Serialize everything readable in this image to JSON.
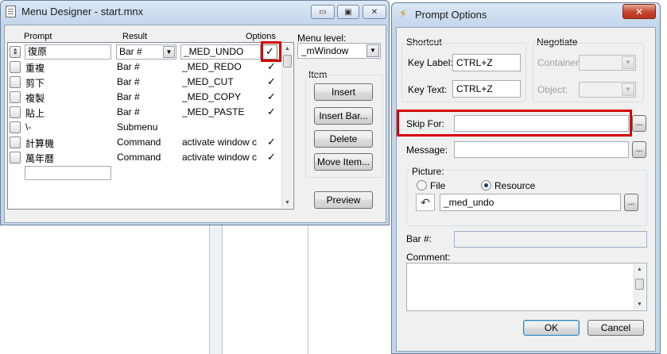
{
  "menu_designer": {
    "title": "Menu Designer - start.mnx",
    "minimize_glyph": "▭",
    "maximize_glyph": "▣",
    "close_glyph": "✕",
    "columns": {
      "prompt": "Prompt",
      "result": "Result",
      "options": "Options"
    },
    "rows": [
      {
        "prompt": "復原",
        "result": "Bar #",
        "target": "_MED_UNDO",
        "check": "✓"
      },
      {
        "prompt": "重複",
        "result": "Bar #",
        "target": "_MED_REDO",
        "check": "✓"
      },
      {
        "prompt": "剪下",
        "result": "Bar #",
        "target": "_MED_CUT",
        "check": "✓"
      },
      {
        "prompt": "複製",
        "result": "Bar #",
        "target": "_MED_COPY",
        "check": "✓"
      },
      {
        "prompt": "貼上",
        "result": "Bar #",
        "target": "_MED_PASTE",
        "check": "✓"
      },
      {
        "prompt": "\\-",
        "result": "Submenu",
        "target": "",
        "check": ""
      },
      {
        "prompt": "計算機",
        "result": "Command",
        "target": "activate window c",
        "check": "✓"
      },
      {
        "prompt": "萬年曆",
        "result": "Command",
        "target": "activate window c",
        "check": "✓"
      }
    ],
    "menu_level_label": "Menu level:",
    "menu_level_value": "_mWindow",
    "item_group_label": "Item",
    "buttons": {
      "insert": "Insert",
      "insert_bar": "Insert Bar...",
      "delete": "Delete",
      "move_item": "Move Item...",
      "preview": "Preview"
    }
  },
  "prompt_options": {
    "title": "Prompt Options",
    "close_glyph": "✕",
    "shortcut_group": "Shortcut",
    "key_label_label": "Key Label:",
    "key_label_value": "CTRL+Z",
    "key_text_label": "Key Text:",
    "key_text_value": "CTRL+Z",
    "negotiate_group": "Negotiate",
    "container_label": "Container:",
    "object_label": "Object:",
    "skip_for_label": "Skip For:",
    "skip_for_value": "",
    "message_label": "Message:",
    "message_value": "",
    "ellipsis": "...",
    "picture_group": "Picture:",
    "file_label": "File",
    "resource_label": "Resource",
    "picture_value": "_med_undo",
    "bar_no_label": "Bar #:",
    "comment_label": "Comment:",
    "ok_label": "OK",
    "cancel_label": "Cancel"
  },
  "colors": {
    "highlight": "#d40000",
    "title_bar": "#c4d6ec"
  }
}
